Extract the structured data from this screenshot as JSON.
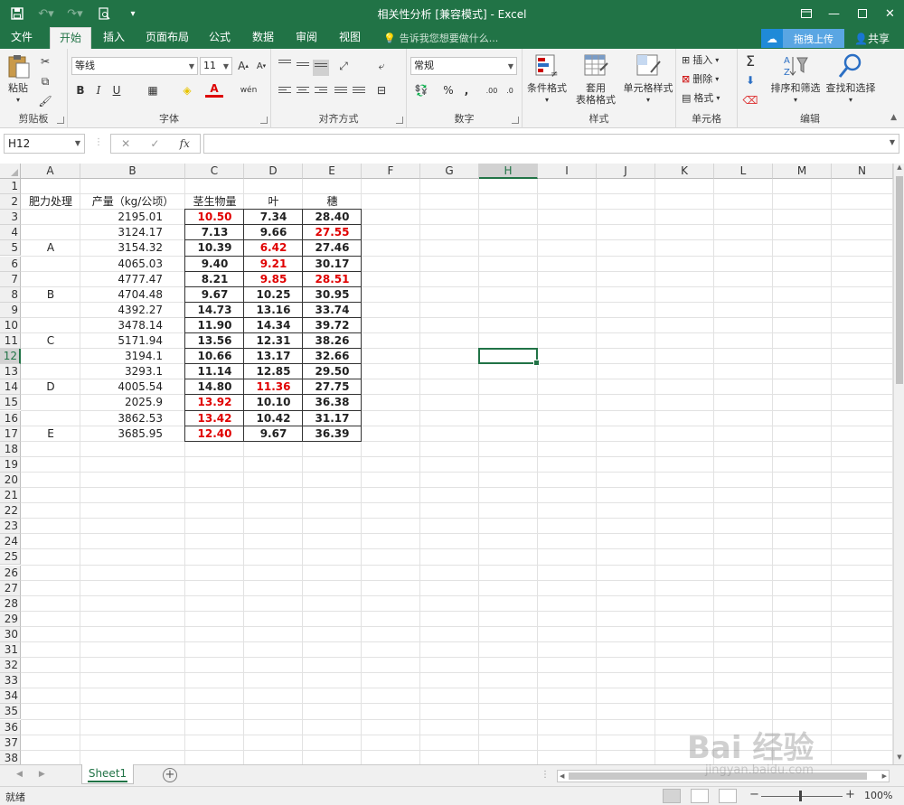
{
  "app": {
    "title": "相关性分析  [兼容模式] - Excel",
    "accent": "#217346"
  },
  "qat": {
    "icons": [
      "save-icon",
      "undo-icon",
      "redo-icon",
      "print-preview-icon",
      "customize-icon"
    ]
  },
  "tabs": [
    {
      "label": "文件"
    },
    {
      "label": "开始"
    },
    {
      "label": "插入"
    },
    {
      "label": "页面布局"
    },
    {
      "label": "公式"
    },
    {
      "label": "数据"
    },
    {
      "label": "审阅"
    },
    {
      "label": "视图"
    }
  ],
  "tell_me": "告诉我您想要做什么...",
  "cloud_upload": "拖拽上传",
  "share": "共享",
  "ribbon": {
    "clipboard": {
      "label": "剪贴板",
      "paste": "粘贴"
    },
    "font": {
      "label": "字体",
      "name": "等线",
      "size": "11",
      "bold": "B",
      "italic": "I",
      "underline": "U"
    },
    "alignment": {
      "label": "对齐方式"
    },
    "number": {
      "label": "数字",
      "format": "常规",
      "percent": "%",
      "comma": ","
    },
    "styles": {
      "label": "样式",
      "cond_format": "条件格式",
      "table_format_1": "套用",
      "table_format_2": "表格格式",
      "cell_styles": "单元格样式"
    },
    "cells": {
      "label": "单元格",
      "insert": "插入",
      "delete": "删除",
      "format": "格式"
    },
    "editing": {
      "label": "编辑",
      "sort_filter": "排序和筛选",
      "find_select": "查找和选择"
    }
  },
  "namebox": "H12",
  "formula": "",
  "columns": [
    "A",
    "B",
    "C",
    "D",
    "E",
    "F",
    "G",
    "H",
    "I",
    "J",
    "K",
    "L",
    "M",
    "N"
  ],
  "rows": [
    "1",
    "2",
    "3",
    "4",
    "5",
    "6",
    "7",
    "8",
    "9",
    "10",
    "11",
    "12",
    "13",
    "14",
    "15",
    "16",
    "17",
    "18",
    "19",
    "20",
    "21",
    "22",
    "23",
    "24",
    "25",
    "26",
    "27",
    "28",
    "29",
    "30",
    "31",
    "32",
    "33",
    "34",
    "35",
    "36",
    "37",
    "38"
  ],
  "selected_cell": "H12",
  "table": {
    "headers": [
      "肥力处理",
      "产量（kg/公顷）",
      "茎生物量",
      "叶",
      "穗"
    ],
    "groups": [
      {
        "label": "A",
        "row": 3
      },
      {
        "label": "B",
        "row": 6
      },
      {
        "label": "C",
        "row": 9
      },
      {
        "label": "D",
        "row": 12
      },
      {
        "label": "E",
        "row": 15
      }
    ],
    "rows": [
      {
        "yield": "2195.01",
        "stem": "10.50",
        "leaf": "7.34",
        "ear": "28.40",
        "red": [
          "stem"
        ]
      },
      {
        "yield": "3124.17",
        "stem": "7.13",
        "leaf": "9.66",
        "ear": "27.55",
        "red": [
          "ear"
        ]
      },
      {
        "yield": "3154.32",
        "stem": "10.39",
        "leaf": "6.42",
        "ear": "27.46",
        "red": [
          "leaf"
        ]
      },
      {
        "yield": "4065.03",
        "stem": "9.40",
        "leaf": "9.21",
        "ear": "30.17",
        "red": [
          "leaf"
        ]
      },
      {
        "yield": "4777.47",
        "stem": "8.21",
        "leaf": "9.85",
        "ear": "28.51",
        "red": [
          "leaf",
          "ear"
        ]
      },
      {
        "yield": "4704.48",
        "stem": "9.67",
        "leaf": "10.25",
        "ear": "30.95",
        "red": []
      },
      {
        "yield": "4392.27",
        "stem": "14.73",
        "leaf": "13.16",
        "ear": "33.74",
        "red": []
      },
      {
        "yield": "3478.14",
        "stem": "11.90",
        "leaf": "14.34",
        "ear": "39.72",
        "red": []
      },
      {
        "yield": "5171.94",
        "stem": "13.56",
        "leaf": "12.31",
        "ear": "38.26",
        "red": []
      },
      {
        "yield": "3194.1",
        "stem": "10.66",
        "leaf": "13.17",
        "ear": "32.66",
        "red": []
      },
      {
        "yield": "3293.1",
        "stem": "11.14",
        "leaf": "12.85",
        "ear": "29.50",
        "red": []
      },
      {
        "yield": "4005.54",
        "stem": "14.80",
        "leaf": "11.36",
        "ear": "27.75",
        "red": [
          "leaf"
        ]
      },
      {
        "yield": "2025.9",
        "stem": "13.92",
        "leaf": "10.10",
        "ear": "36.38",
        "red": [
          "stem"
        ]
      },
      {
        "yield": "3862.53",
        "stem": "13.42",
        "leaf": "10.42",
        "ear": "31.17",
        "red": [
          "stem"
        ]
      },
      {
        "yield": "3685.95",
        "stem": "12.40",
        "leaf": "9.67",
        "ear": "36.39",
        "red": [
          "stem"
        ]
      }
    ],
    "red_color": "#e00000"
  },
  "sheet_tab": "Sheet1",
  "status": {
    "ready": "就绪",
    "zoom": "100%"
  },
  "watermark": {
    "main": "Bai 经验",
    "sub": "jingyan.baidu.com"
  }
}
